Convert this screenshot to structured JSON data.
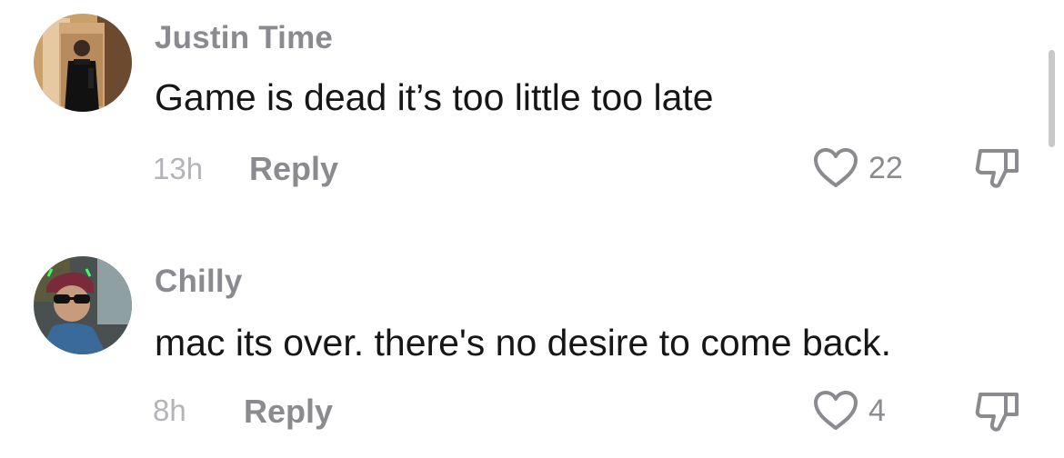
{
  "comments": [
    {
      "username": "Justin Time",
      "text": "Game is dead it’s too little too late",
      "time": "13h",
      "reply_label": "Reply",
      "likes": "22"
    },
    {
      "username": "Chilly",
      "text": "mac its over. there's no desire to come back.",
      "time": "8h",
      "reply_label": "Reply",
      "likes": "4"
    }
  ],
  "icons": {
    "like": "heart-outline-icon",
    "dislike": "thumbs-down-outline-icon"
  },
  "colors": {
    "text_primary": "#161616",
    "text_secondary": "#8a8a8f",
    "timestamp": "#b3b3b8"
  }
}
